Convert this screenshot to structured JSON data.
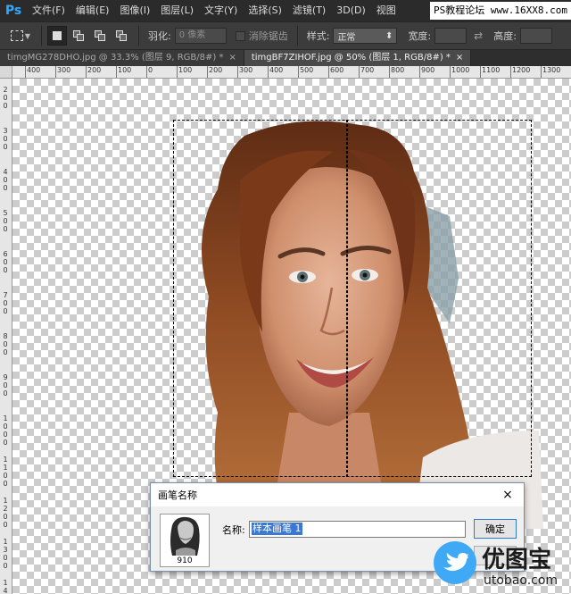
{
  "app": {
    "logo": "Ps"
  },
  "menu": [
    {
      "label": "文件(F)"
    },
    {
      "label": "编辑(E)"
    },
    {
      "label": "图像(I)"
    },
    {
      "label": "图层(L)"
    },
    {
      "label": "文字(Y)"
    },
    {
      "label": "选择(S)"
    },
    {
      "label": "滤镜(T)"
    },
    {
      "label": "3D(D)"
    },
    {
      "label": "视图"
    }
  ],
  "watermark_top": "PS教程论坛 www.16XX8.com",
  "options": {
    "feather_label": "羽化:",
    "feather_value": "0 像素",
    "antialias_label": "消除锯齿",
    "style_label": "样式:",
    "style_value": "正常",
    "width_label": "宽度:",
    "height_label": "高度:"
  },
  "tabs": [
    {
      "label": "timgMG278DHO.jpg @ 33.3% (图层 9, RGB/8#) *",
      "close": "×"
    },
    {
      "label": "timgBF7ZIHOF.jpg @ 50% (图层 1, RGB/8#) *",
      "close": "×"
    }
  ],
  "ruler_h": [
    "400",
    "300",
    "200",
    "100",
    "0",
    "100",
    "200",
    "300",
    "400",
    "500",
    "600",
    "700",
    "800",
    "900",
    "1000",
    "1100",
    "1200",
    "1300",
    "1400"
  ],
  "ruler_v": [
    "200",
    "300",
    "400",
    "500",
    "600",
    "700",
    "800",
    "900",
    "1000",
    "1100",
    "1200",
    "1300",
    "1400"
  ],
  "dialog": {
    "title": "画笔名称",
    "close": "×",
    "thumb_number": "910",
    "name_label": "名称:",
    "name_value": "样本画笔 1",
    "ok_label": "确定"
  },
  "watermark_bottom": {
    "brand": "优图宝",
    "url": "utobao.com"
  },
  "colors": {
    "menubar": "#2b2b2b",
    "options": "#3c3c3c",
    "accent": "#31a8ff",
    "selection_highlight": "#3a78d4"
  }
}
